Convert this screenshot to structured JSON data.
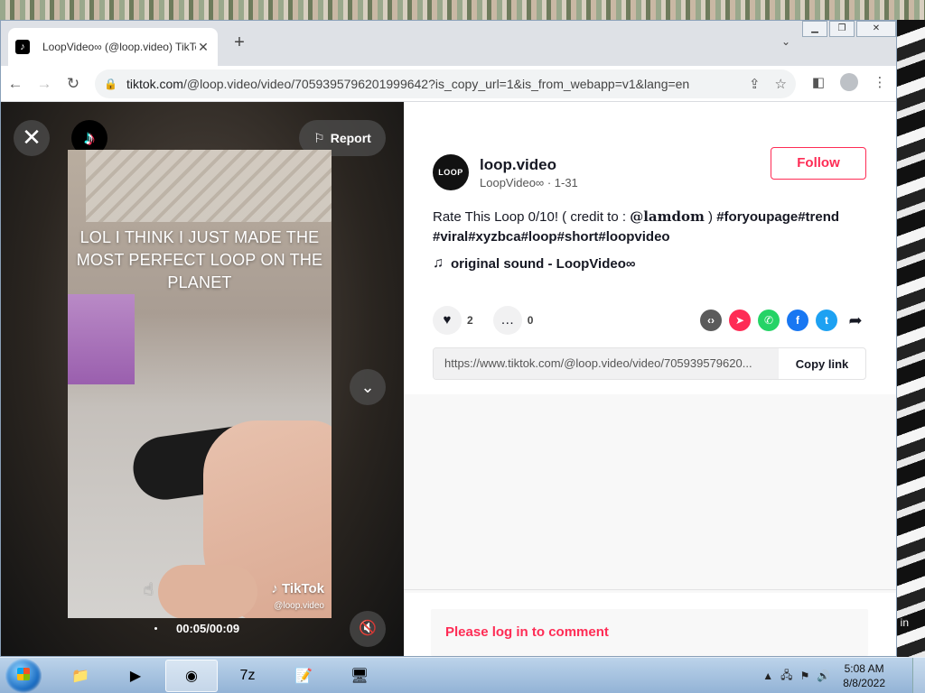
{
  "browser": {
    "tab_title": "LoopVideo∞ (@loop.video) TikTo",
    "url_host": "tiktok.com",
    "url_path": "/@loop.video/video/7059395796201999642?is_copy_url=1&is_from_webapp=v1&lang=en"
  },
  "video": {
    "report_label": "Report",
    "caption_text": "LOL I THINK I JUST MADE THE MOST PERFECT LOOP ON THE PLANET",
    "watermark_logo": "♪ TikTok",
    "watermark_user": "@loop.video",
    "time": "00:05/00:09"
  },
  "author": {
    "avatar_text": "LOOP",
    "handle": "loop.video",
    "subline": "LoopVideo∞ · 1-31",
    "follow_label": "Follow"
  },
  "description": {
    "text_before": "Rate This Loop 0/10! ( credit to : ",
    "mention": "@𝐥𝐚𝐦𝐝𝐨𝐦",
    "text_after": " ) ",
    "tags": "#foryoupage#trend #viral#xyzbca#loop#short#loopvideo"
  },
  "sound": {
    "label": "original sound - LoopVideo∞"
  },
  "actions": {
    "likes": "2",
    "comments": "0"
  },
  "share": {
    "link": "https://www.tiktok.com/@loop.video/video/705939579620...",
    "copy_label": "Copy link"
  },
  "comments": {
    "login_prompt": "Please log in to comment"
  },
  "desktop": {
    "edge_text": "in"
  },
  "taskbar": {
    "time": "5:08 AM",
    "date": "8/8/2022"
  },
  "colors": {
    "accent": "#fe2c55",
    "embed": "#5b5b5b",
    "tiktok_share": "#fe2c55",
    "whatsapp": "#25d366",
    "facebook": "#1877f2",
    "twitter": "#1da1f2"
  }
}
